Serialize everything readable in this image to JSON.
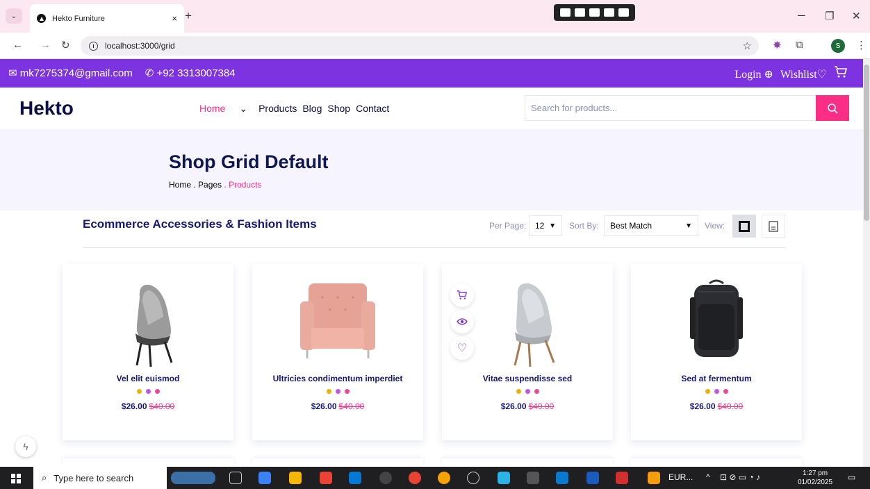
{
  "browser": {
    "tab_title": "Hekto Furniture",
    "tab_close": "×",
    "new_tab": "+",
    "url": "localhost:3000/grid",
    "profile_initial": "S"
  },
  "topbar": {
    "email": "mk7275374@gmail.com",
    "phone": "+92 3313007384",
    "login": "Login",
    "wishlist": "Wishlist"
  },
  "header": {
    "logo": "Hekto",
    "nav": {
      "home": "Home",
      "products": "Products",
      "blog": "Blog",
      "shop": "Shop",
      "contact": "Contact"
    },
    "search_placeholder": "Search for products..."
  },
  "banner": {
    "title": "Shop Grid Default",
    "crumb_home": "Home",
    "crumb_pages": ". Pages",
    "crumb_current": ". Products"
  },
  "toolbar": {
    "title": "Ecommerce Accessories & Fashion Items",
    "per_page_label": "Per Page:",
    "per_page_value": "12",
    "sort_label": "Sort By:",
    "sort_value": "Best Match",
    "view_label": "View:"
  },
  "products": [
    {
      "name": "Vel elit euismod",
      "price": "$26.00",
      "old_price": "$40.00",
      "image": "grey-lounge-chair"
    },
    {
      "name": "Ultricies condimentum imperdiet",
      "price": "$26.00",
      "old_price": "$40.00",
      "image": "pink-armchair"
    },
    {
      "name": "Vitae suspendisse sed",
      "price": "$26.00",
      "old_price": "$40.00",
      "image": "light-grey-lounge-chair"
    },
    {
      "name": "Sed at fermentum",
      "price": "$26.00",
      "old_price": "$40.00",
      "image": "black-backpack"
    }
  ],
  "colors": {
    "accent": "#fb2e86",
    "topbar": "#7e33e0",
    "navy": "#151875",
    "dot_yellow": "#de9034",
    "dot_purple": "#ec42a2",
    "dot_pink": "#8568ff"
  },
  "taskbar": {
    "search_placeholder": "Type here to search",
    "tray_label": "EUR...",
    "time": "1:27 pm",
    "date": "01/02/2025"
  }
}
